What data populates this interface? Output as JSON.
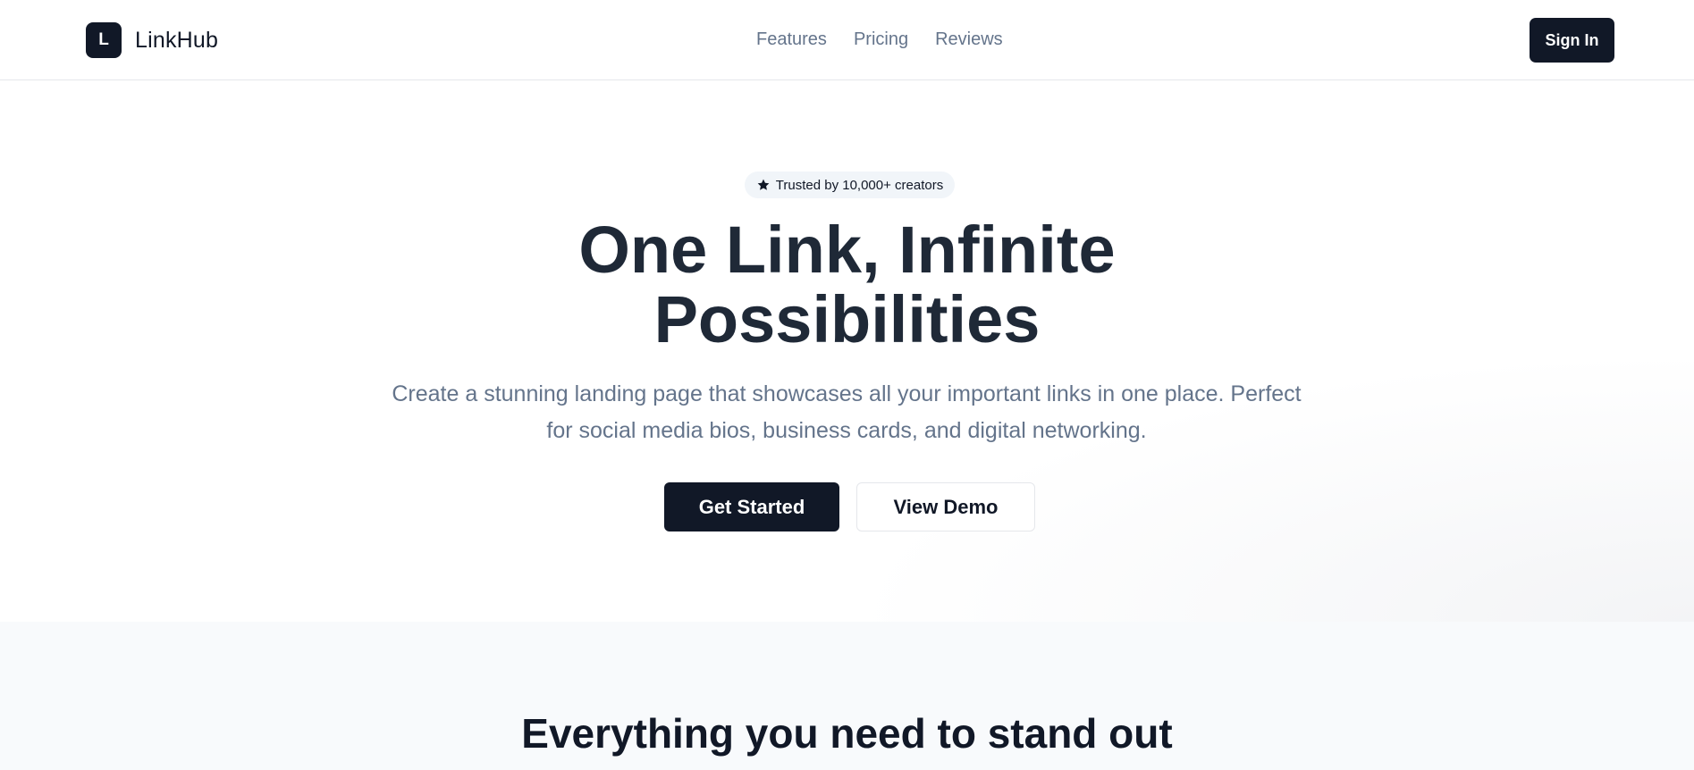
{
  "brand": {
    "logo_letter": "L",
    "name": "LinkHub"
  },
  "nav": {
    "items": [
      "Features",
      "Pricing",
      "Reviews"
    ]
  },
  "header": {
    "signin_label": "Sign In"
  },
  "hero": {
    "badge_icon": "star-icon",
    "badge_text": "Trusted by 10,000+ creators",
    "title_line1": "One Link, Infinite",
    "title_line2": "Possibilities",
    "subtitle": "Create a stunning landing page that showcases all your important links in one place. Perfect for social media bios, business cards, and digital networking.",
    "primary_cta": "Get Started",
    "secondary_cta": "View Demo"
  },
  "features": {
    "title": "Everything you need to stand out"
  },
  "colors": {
    "primary": "#111827",
    "muted_text": "#64748b",
    "badge_bg": "#f1f5f9",
    "section_bg": "#f8fafc"
  }
}
